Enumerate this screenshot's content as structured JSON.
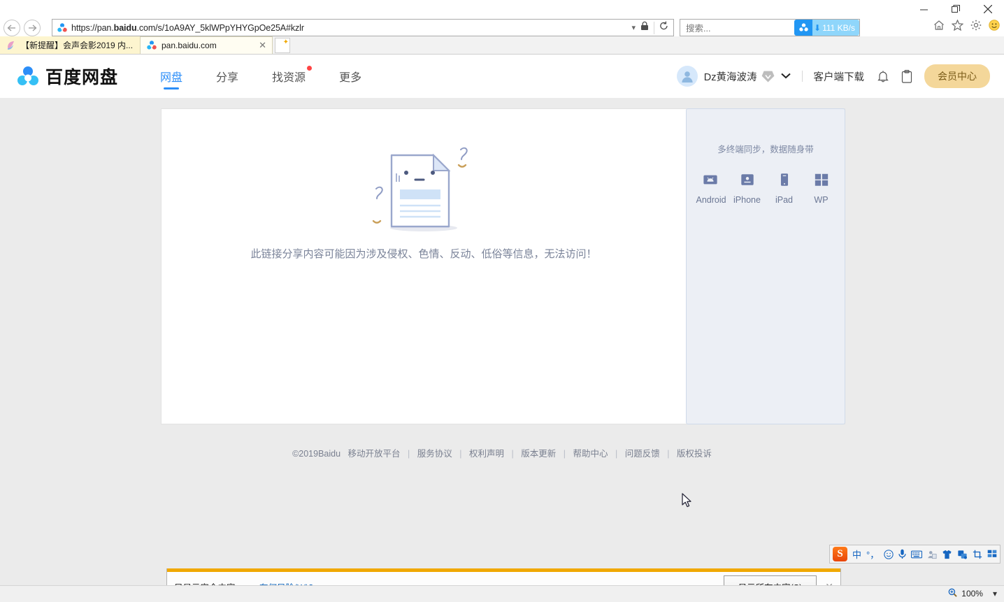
{
  "window": {
    "minimize": "—",
    "maximize": "❐",
    "close": "✕"
  },
  "browser": {
    "back_icon": "back-arrow-icon",
    "forward_icon": "forward-arrow-icon",
    "url": "https://pan.baidu.com/s/1oA9AY_5klWPpYHYGpOe25A#kzlr",
    "url_prefix": "https://pan.",
    "url_domain": "baidu",
    "url_suffix": ".com/s/1oA9AY_5klWPpYHYGpOe25A#kzlr",
    "dropdown_icon": "▾",
    "lock_icon": "lock-icon",
    "refresh_icon": "↻",
    "search_placeholder": "搜索...",
    "download_speed": "111 KB/s",
    "download_arrow": "⬇",
    "tabs": [
      {
        "title": "【新提醒】会声会影2019 内...",
        "active": false,
        "closable": false
      },
      {
        "title": "pan.baidu.com",
        "active": true,
        "closable": true,
        "close_label": "✕"
      }
    ],
    "newtab_label": "+"
  },
  "site": {
    "logo_text": "百度网盘",
    "nav": [
      {
        "label": "网盘",
        "active": true,
        "dot": false
      },
      {
        "label": "分享",
        "active": false,
        "dot": false
      },
      {
        "label": "找资源",
        "active": false,
        "dot": true
      },
      {
        "label": "更多",
        "active": false,
        "dot": false
      }
    ],
    "user": {
      "name": "Dz黄海波涛",
      "vip_badge": "vip-heart-badge-icon",
      "chevron": "⌄",
      "client_download": "客户端下载",
      "bell_icon": "bell-icon",
      "clipboard_icon": "clipboard-icon",
      "member_center": "会员中心"
    }
  },
  "content": {
    "error_message": "此链接分享内容可能因为涉及侵权、色情、反动、低俗等信息，无法访问！",
    "illustration": "broken-document-illustration"
  },
  "sidepanel": {
    "title": "多终端同步，数据随身带",
    "platforms": [
      {
        "label": "Android",
        "icon": "android-icon"
      },
      {
        "label": "iPhone",
        "icon": "iphone-icon"
      },
      {
        "label": "iPad",
        "icon": "ipad-icon"
      },
      {
        "label": "WP",
        "icon": "windows-phone-icon"
      }
    ]
  },
  "footer": {
    "copyright": "©2019Baidu",
    "links": [
      "移动开放平台",
      "服务协议",
      "权利声明",
      "版本更新",
      "帮助中心",
      "问题反馈",
      "版权投诉"
    ]
  },
  "ime": {
    "logo": "S",
    "items": [
      "中",
      "°，",
      "☺",
      "mic-icon",
      "keyboard-icon",
      "user-icon",
      "shirt-icon",
      "toolbox-icon",
      "crop-icon",
      "grid-icon"
    ]
  },
  "security_bar": {
    "message": "只显示安全内容。",
    "link": "有何风险(W)?",
    "button": "显示所有内容(S)",
    "close": "✕"
  },
  "statusbar": {
    "zoom_level": "100%",
    "zoom_icon": "magnifier-plus-icon",
    "zoom_chevron": "▾"
  },
  "colors": {
    "accent_blue": "#2c8ef8",
    "vip_gold": "#f4d79a",
    "warning_orange": "#f0a800",
    "panel_bg": "#eceff5"
  }
}
